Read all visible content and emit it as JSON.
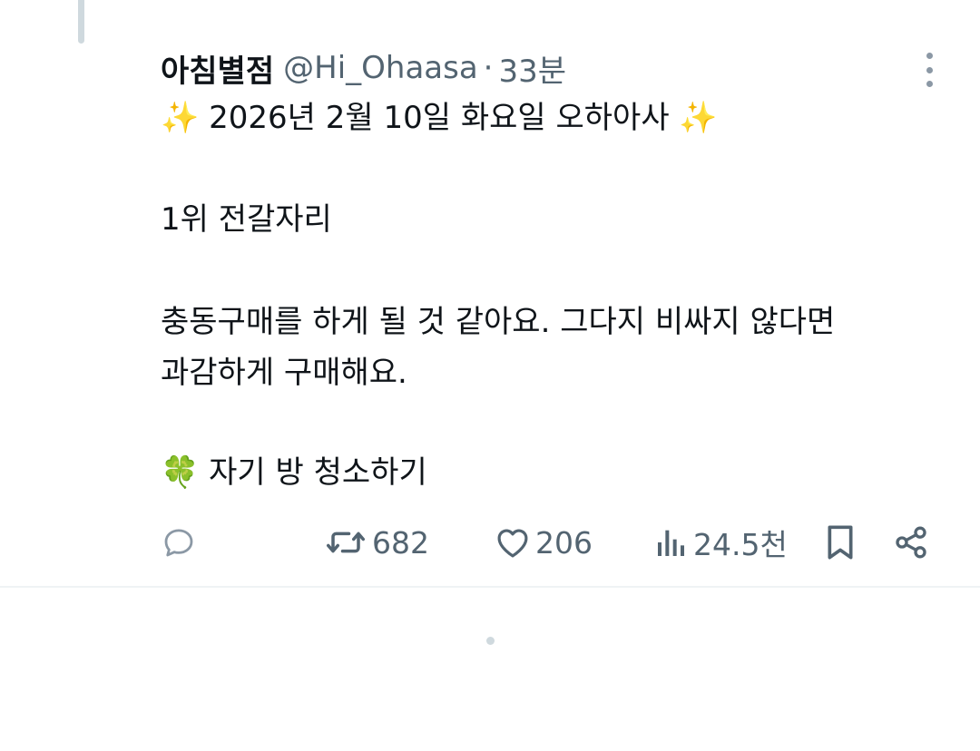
{
  "tweet": {
    "display_name": "아침별점",
    "handle": "@Hi_Ohaasa",
    "separator": "·",
    "time_ago": "33분",
    "lines": {
      "headline_text": "2026년 2월 10일 화요일 오하아사",
      "sparkle_emoji": "✨",
      "rank": "1위 전갈자리",
      "body_1": "충동구매를 하게 될 것 같아요. 그다지 비싸지 않다면",
      "body_2": "과감하게 구매해요.",
      "lucky_emoji": "🍀",
      "lucky_text": "자기 방 청소하기"
    }
  },
  "actions": {
    "reply_icon": "reply-bubble-icon",
    "retweet_icon": "retweet-icon",
    "retweet_count": "682",
    "like_icon": "heart-icon",
    "like_count": "206",
    "views_icon": "views-bar-chart-icon",
    "views_count": "24.5천",
    "bookmark_icon": "bookmark-icon",
    "share_icon": "share-icon"
  },
  "colors": {
    "text": "#0f1419",
    "secondary": "#536471",
    "divider": "#eff3f4"
  }
}
